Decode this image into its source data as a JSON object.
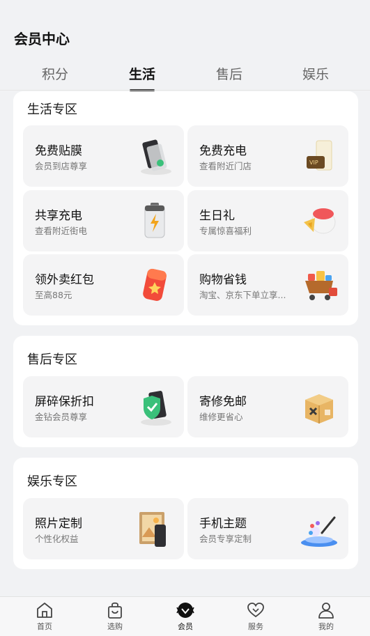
{
  "header": {
    "title": "会员中心"
  },
  "tabs": [
    {
      "label": "积分"
    },
    {
      "label": "生活"
    },
    {
      "label": "售后"
    },
    {
      "label": "娱乐"
    }
  ],
  "sections": {
    "life": {
      "title": "生活专区",
      "cards": [
        {
          "title": "免费贴膜",
          "subtitle": "会员到店尊享",
          "icon": "screen-film-icon"
        },
        {
          "title": "免费充电",
          "subtitle": "查看附近门店",
          "icon": "vip-card-icon"
        },
        {
          "title": "共享充电",
          "subtitle": "查看附近街电",
          "icon": "battery-icon"
        },
        {
          "title": "生日礼",
          "subtitle": "专属惊喜福利",
          "icon": "birthday-cake-icon"
        },
        {
          "title": "领外卖红包",
          "subtitle": "至高88元",
          "icon": "red-packet-icon"
        },
        {
          "title": "购物省钱",
          "subtitle": "淘宝、京东下单立享...",
          "icon": "shopping-cart-icon"
        }
      ]
    },
    "aftersales": {
      "title": "售后专区",
      "cards": [
        {
          "title": "屏碎保折扣",
          "subtitle": "金钻会员尊享",
          "icon": "shield-phone-icon"
        },
        {
          "title": "寄修免邮",
          "subtitle": "维修更省心",
          "icon": "repair-box-icon"
        }
      ]
    },
    "entertainment": {
      "title": "娱乐专区",
      "cards": [
        {
          "title": "照片定制",
          "subtitle": "个性化权益",
          "icon": "photo-frame-icon"
        },
        {
          "title": "手机主题",
          "subtitle": "会员专享定制",
          "icon": "theme-palette-icon"
        }
      ]
    }
  },
  "bottom_nav": [
    {
      "label": "首页",
      "icon": "home-icon"
    },
    {
      "label": "选购",
      "icon": "shopping-bag-icon"
    },
    {
      "label": "会员",
      "icon": "member-icon"
    },
    {
      "label": "服务",
      "icon": "heart-service-icon"
    },
    {
      "label": "我的",
      "icon": "user-icon"
    }
  ]
}
